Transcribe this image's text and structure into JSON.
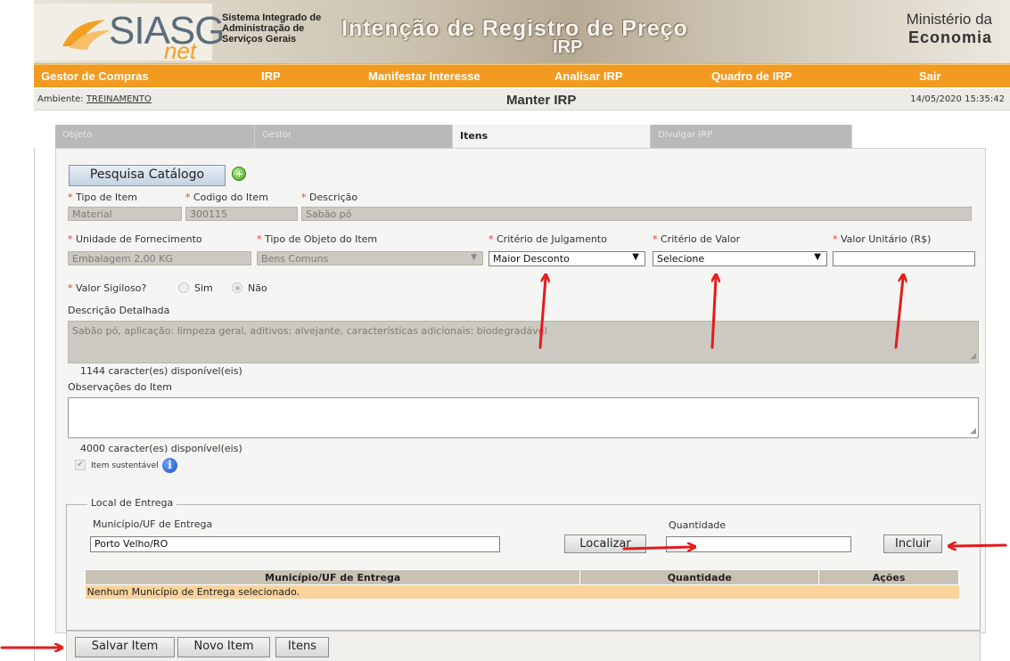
{
  "header": {
    "logo_text": "SIASG",
    "logo_sub": "net",
    "system_name_lines": [
      "Sistema Integrado de",
      "Administração de",
      "Serviços Gerais"
    ],
    "banner_title": "Intenção de Registro de Preço",
    "banner_sub": "IRP",
    "ministry_line1": "Ministério da",
    "ministry_line2": "Economia"
  },
  "nav": {
    "items": [
      {
        "label": "Gestor de Compras"
      },
      {
        "label": "IRP"
      },
      {
        "label": "Manifestar Interesse"
      },
      {
        "label": "Analisar IRP"
      },
      {
        "label": "Quadro de IRP"
      },
      {
        "label": "Sair"
      }
    ]
  },
  "ambient": {
    "label": "Ambiente:",
    "value": "TREINAMENTO",
    "page_title": "Manter IRP",
    "datetime": "14/05/2020 15:35:42"
  },
  "tabs": [
    {
      "label": "Objeto",
      "active": false
    },
    {
      "label": "Gestor",
      "active": false
    },
    {
      "label": "Itens",
      "active": true
    },
    {
      "label": "Divulgar IRP",
      "active": false
    }
  ],
  "form": {
    "search_button": "Pesquisa Catálogo",
    "tipo_item": {
      "label": "Tipo de Item",
      "value": "Material"
    },
    "codigo_item": {
      "label": "Codigo do Item",
      "value": "300115"
    },
    "descricao": {
      "label": "Descrição",
      "value": "Sabão pó"
    },
    "unidade": {
      "label": "Unidade de Fornecimento",
      "value": "Embalagem 2,00 KG"
    },
    "tipo_objeto": {
      "label": "Tipo de Objeto do Item",
      "value": "Bens Comuns"
    },
    "criterio_julgamento": {
      "label": "Critério de Julgamento",
      "value": "Maior Desconto"
    },
    "criterio_valor": {
      "label": "Critério de Valor",
      "value": "Selecione"
    },
    "valor_unitario": {
      "label": "Valor Unitário (R$)",
      "value": ""
    },
    "valor_sigiloso": {
      "label": "Valor Sigiloso?",
      "opt_yes": "Sim",
      "opt_no": "Não",
      "selected": "Não"
    },
    "descricao_detalhada": {
      "label": "Descrição Detalhada",
      "value": "Sabão pó, aplicação: limpeza geral, aditivos: alvejante, características adicionais: biodegradável",
      "remaining": "1144 caracter(es) disponível(eis)"
    },
    "observacoes": {
      "label": "Observações do Item",
      "value": "",
      "remaining": "4000 caracter(es) disponível(eis)"
    },
    "sustentavel": {
      "label": "Item sustentável",
      "checked": true
    }
  },
  "local_entrega": {
    "legend": "Local de Entrega",
    "municipio_label": "Município/UF de Entrega",
    "municipio_value": "Porto Velho/RO",
    "localizar_button": "Localizar",
    "quantidade_label": "Quantidade",
    "quantidade_value": "",
    "incluir_button": "Incluir",
    "table": {
      "columns": [
        "Município/UF de Entrega",
        "Quantidade",
        "Ações"
      ],
      "empty_message": "Nenhum Município de Entrega selecionado."
    }
  },
  "bottom_buttons": {
    "salvar": "Salvar Item",
    "novo": "Novo Item",
    "itens": "Itens"
  },
  "colors": {
    "nav_orange": "#f39a20",
    "annotation_arrow": "#e31b1b",
    "table_row": "#f9d39b",
    "required_star": "#e53a2e"
  }
}
